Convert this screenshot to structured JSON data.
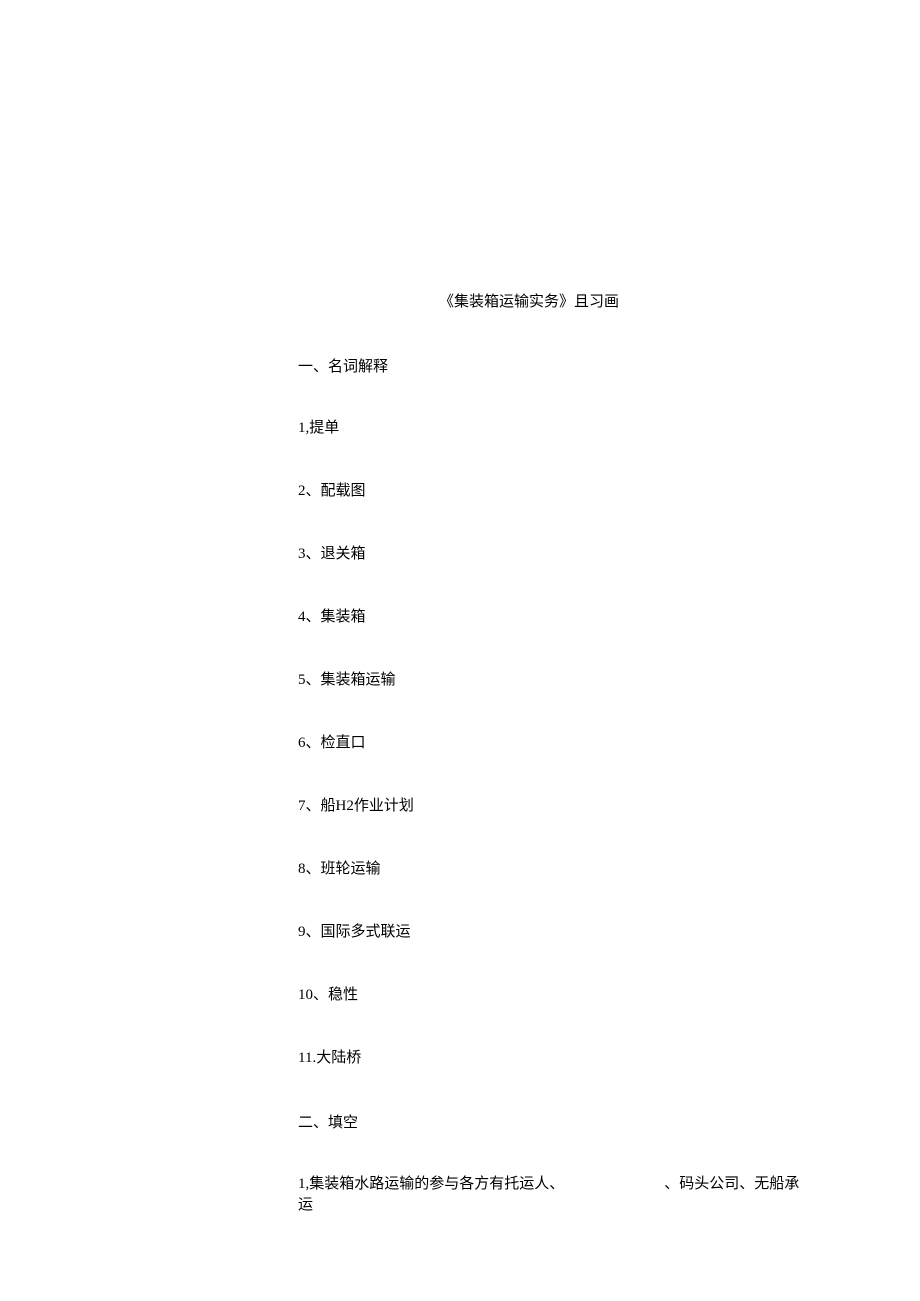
{
  "title": "《集装箱运输实务》且习画",
  "section1": {
    "heading": "一、名词解释",
    "items": [
      "1,提单",
      "2、配载图",
      "3、退关箱",
      "4、集装箱",
      "5、集装箱运输",
      "6、检直口",
      "7、船H2作业计划",
      "8、班轮运输",
      "9、国际多式联运",
      "10、稳性",
      "11.大陆桥"
    ]
  },
  "section2": {
    "heading": "二、填空",
    "items": [
      {
        "prefix": "1,集装箱水路运输的参与各方有托运人、",
        "suffix": "、码头公司、无船承运"
      }
    ]
  }
}
